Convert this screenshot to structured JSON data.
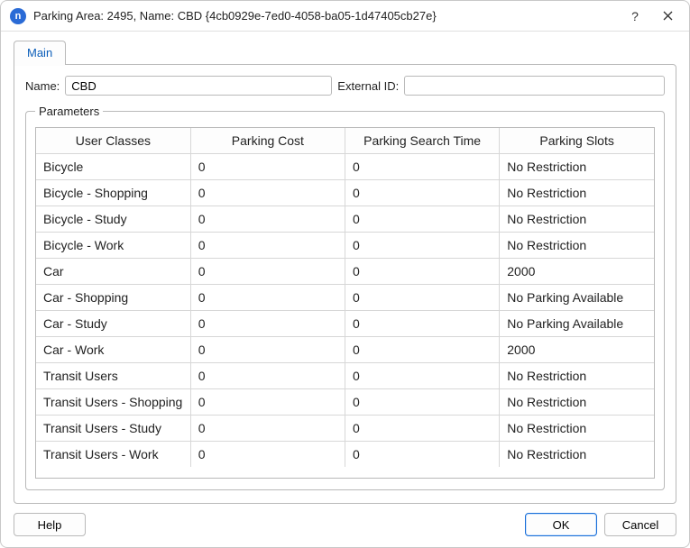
{
  "window": {
    "title": "Parking Area: 2495, Name: CBD  {4cb0929e-7ed0-4058-ba05-1d47405cb27e}",
    "icon_letter": "n"
  },
  "tabs": {
    "main": "Main"
  },
  "form": {
    "name_label": "Name:",
    "name_value": "CBD",
    "extid_label": "External ID:",
    "extid_value": ""
  },
  "parameters": {
    "legend": "Parameters",
    "headers": [
      "User Classes",
      "Parking Cost",
      "Parking Search Time",
      "Parking Slots"
    ],
    "rows": [
      {
        "user_class": "Bicycle",
        "cost": "0",
        "search_time": "0",
        "slots": "No Restriction"
      },
      {
        "user_class": "Bicycle - Shopping",
        "cost": "0",
        "search_time": "0",
        "slots": "No Restriction"
      },
      {
        "user_class": "Bicycle - Study",
        "cost": "0",
        "search_time": "0",
        "slots": "No Restriction"
      },
      {
        "user_class": "Bicycle - Work",
        "cost": "0",
        "search_time": "0",
        "slots": "No Restriction"
      },
      {
        "user_class": "Car",
        "cost": "0",
        "search_time": "0",
        "slots": "2000"
      },
      {
        "user_class": "Car - Shopping",
        "cost": "0",
        "search_time": "0",
        "slots": "No Parking Available"
      },
      {
        "user_class": "Car - Study",
        "cost": "0",
        "search_time": "0",
        "slots": "No Parking Available"
      },
      {
        "user_class": "Car - Work",
        "cost": "0",
        "search_time": "0",
        "slots": "2000"
      },
      {
        "user_class": "Transit Users",
        "cost": "0",
        "search_time": "0",
        "slots": "No Restriction"
      },
      {
        "user_class": "Transit Users - Shopping",
        "cost": "0",
        "search_time": "0",
        "slots": "No Restriction"
      },
      {
        "user_class": "Transit Users - Study",
        "cost": "0",
        "search_time": "0",
        "slots": "No Restriction"
      },
      {
        "user_class": "Transit Users - Work",
        "cost": "0",
        "search_time": "0",
        "slots": "No Restriction"
      }
    ]
  },
  "footer": {
    "help": "Help",
    "ok": "OK",
    "cancel": "Cancel"
  }
}
